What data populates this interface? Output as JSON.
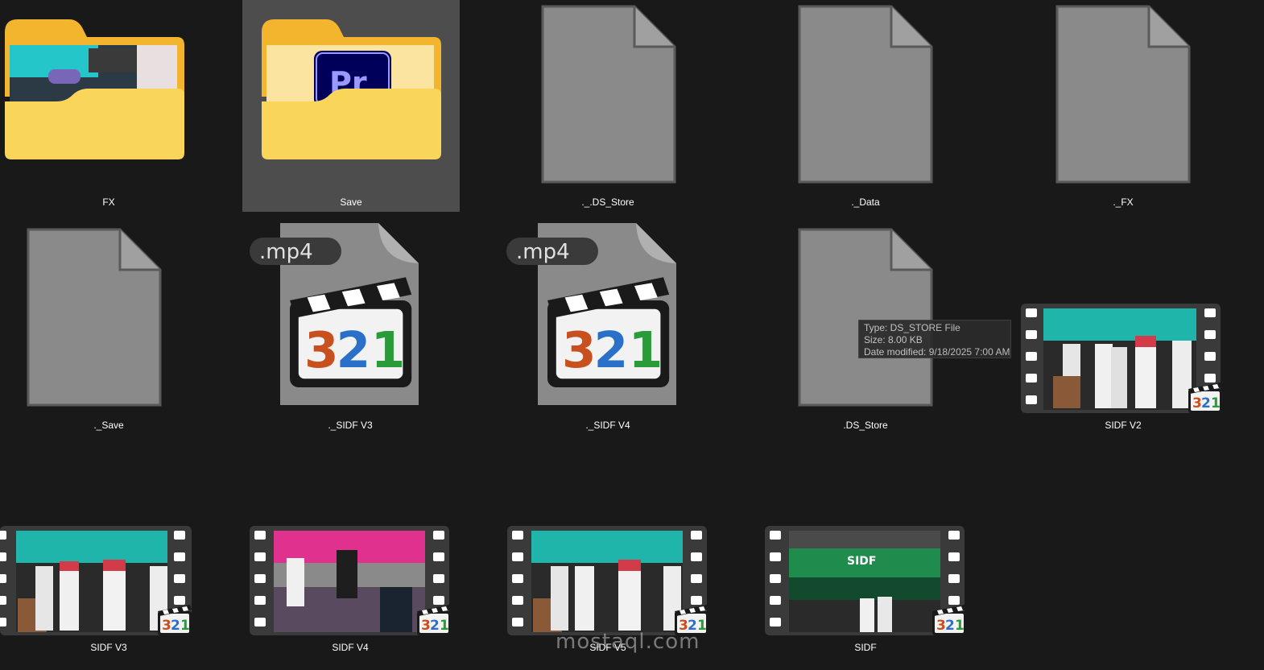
{
  "items": [
    {
      "name": "FX",
      "kind": "folder"
    },
    {
      "name": "Save",
      "kind": "folder-premiere",
      "selected": true
    },
    {
      "name": "._.DS_Store",
      "kind": "file"
    },
    {
      "name": "._Data",
      "kind": "file"
    },
    {
      "name": "._FX",
      "kind": "file"
    },
    {
      "name": "._Save",
      "kind": "file"
    },
    {
      "name": "._SIDF V3",
      "kind": "mp4-unknown",
      "ext": ".mp4",
      "icon_digits": "321"
    },
    {
      "name": "._SIDF V4",
      "kind": "mp4-unknown",
      "ext": ".mp4",
      "icon_digits": "321"
    },
    {
      "name": ".DS_Store",
      "kind": "file"
    },
    {
      "name": "SIDF V2",
      "kind": "video-thumbnail",
      "icon_digits": "321"
    },
    {
      "name": "SIDF V3",
      "kind": "video-thumbnail",
      "icon_digits": "321"
    },
    {
      "name": "SIDF V4",
      "kind": "video-thumbnail",
      "icon_digits": "321"
    },
    {
      "name": "SIDF V5",
      "kind": "video-thumbnail",
      "icon_digits": "321"
    },
    {
      "name": "SIDF",
      "kind": "video-thumbnail",
      "icon_digits": "321",
      "thumb_text": "SIDF"
    }
  ],
  "premiere_badge": "Pr",
  "tooltip": {
    "type": "Type: DS_STORE File",
    "size": "Size: 8.00 KB",
    "modified": "Date modified: 9/18/2025 7:00 AM"
  },
  "watermark": "mostaql.com",
  "colors": {
    "background": "#191919",
    "selection": "#4d4d4d",
    "folder": "#f9c53c",
    "file_page": "#8a8a8a",
    "thumb_teal": "#1fb5aa",
    "thumb_magenta": "#e0318f",
    "thumb_green": "#1f8c4e"
  }
}
